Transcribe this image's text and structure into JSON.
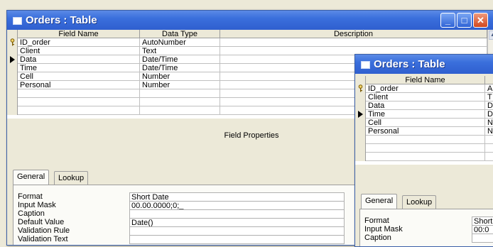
{
  "win1": {
    "title": "Orders : Table",
    "headers": [
      "Field Name",
      "Data Type",
      "Description"
    ],
    "rows": [
      {
        "name": "ID_order",
        "type": "AutoNumber",
        "desc": "",
        "key": true,
        "current": false
      },
      {
        "name": "Client",
        "type": "Text",
        "desc": "",
        "key": false,
        "current": false
      },
      {
        "name": "Data",
        "type": "Date/Time",
        "desc": "",
        "key": false,
        "current": true
      },
      {
        "name": "Time",
        "type": "Date/Time",
        "desc": "",
        "key": false,
        "current": false
      },
      {
        "name": "Cell",
        "type": "Number",
        "desc": "",
        "key": false,
        "current": false
      },
      {
        "name": "Personal",
        "type": "Number",
        "desc": "",
        "key": false,
        "current": false
      }
    ],
    "field_properties_label": "Field Properties",
    "tabs": [
      "General",
      "Lookup"
    ],
    "props": [
      {
        "label": "Format",
        "value": "Short Date"
      },
      {
        "label": "Input Mask",
        "value": "00.00.0000;0;_"
      },
      {
        "label": "Caption",
        "value": ""
      },
      {
        "label": "Default Value",
        "value": "Date()"
      },
      {
        "label": "Validation Rule",
        "value": ""
      },
      {
        "label": "Validation Text",
        "value": ""
      }
    ]
  },
  "win2": {
    "title": "Orders : Table",
    "headers": [
      "Field Name"
    ],
    "rows": [
      {
        "name": "ID_order",
        "type": "A",
        "key": true,
        "current": false
      },
      {
        "name": "Client",
        "type": "T",
        "key": false,
        "current": false
      },
      {
        "name": "Data",
        "type": "D",
        "key": false,
        "current": false
      },
      {
        "name": "Time",
        "type": "D",
        "key": false,
        "current": true
      },
      {
        "name": "Cell",
        "type": "N",
        "key": false,
        "current": false
      },
      {
        "name": "Personal",
        "type": "N",
        "key": false,
        "current": false
      }
    ],
    "tabs": [
      "General",
      "Lookup"
    ],
    "props": [
      {
        "label": "Format",
        "value": "Short"
      },
      {
        "label": "Input Mask",
        "value": "00:0"
      },
      {
        "label": "Caption",
        "value": ""
      }
    ]
  },
  "icons": {
    "key": "key-icon",
    "row_pointer": "row-selector-arrow-icon"
  }
}
